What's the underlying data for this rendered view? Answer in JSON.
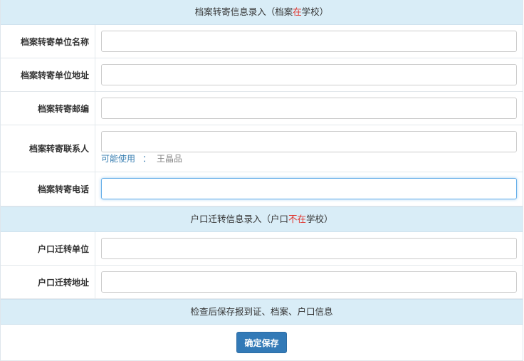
{
  "section1": {
    "title_before": "档案转寄信息录入（档案",
    "title_red": "在",
    "title_after": "学校）"
  },
  "fields1": [
    {
      "label": "档案转寄单位名称",
      "value": "",
      "placeholder": ""
    },
    {
      "label": "档案转寄单位地址",
      "value": "",
      "placeholder": ""
    },
    {
      "label": "档案转寄邮编",
      "value": "",
      "placeholder": ""
    },
    {
      "label": "档案转寄联系人",
      "value": "",
      "placeholder": ""
    },
    {
      "label": "档案转寄电话",
      "value": "",
      "placeholder": ""
    }
  ],
  "contact_hint": {
    "prefix": "可能使用",
    "colon": "：",
    "name": "王晶品"
  },
  "section2": {
    "title_before": "户口迁转信息录入（户口",
    "title_red": "不在",
    "title_after": "学校）"
  },
  "fields2": [
    {
      "label": "户口迁转单位",
      "value": "",
      "placeholder": ""
    },
    {
      "label": "户口迁转地址",
      "value": "",
      "placeholder": ""
    }
  ],
  "section3": {
    "title": "检查后保存报到证、档案、户口信息"
  },
  "save_button": {
    "label": "确定保存",
    "color": "#337ab7"
  },
  "colors": {
    "section_header_bg": "#d9edf7",
    "highlight_red": "#e0322b",
    "hint_link": "#3a7fb2"
  }
}
